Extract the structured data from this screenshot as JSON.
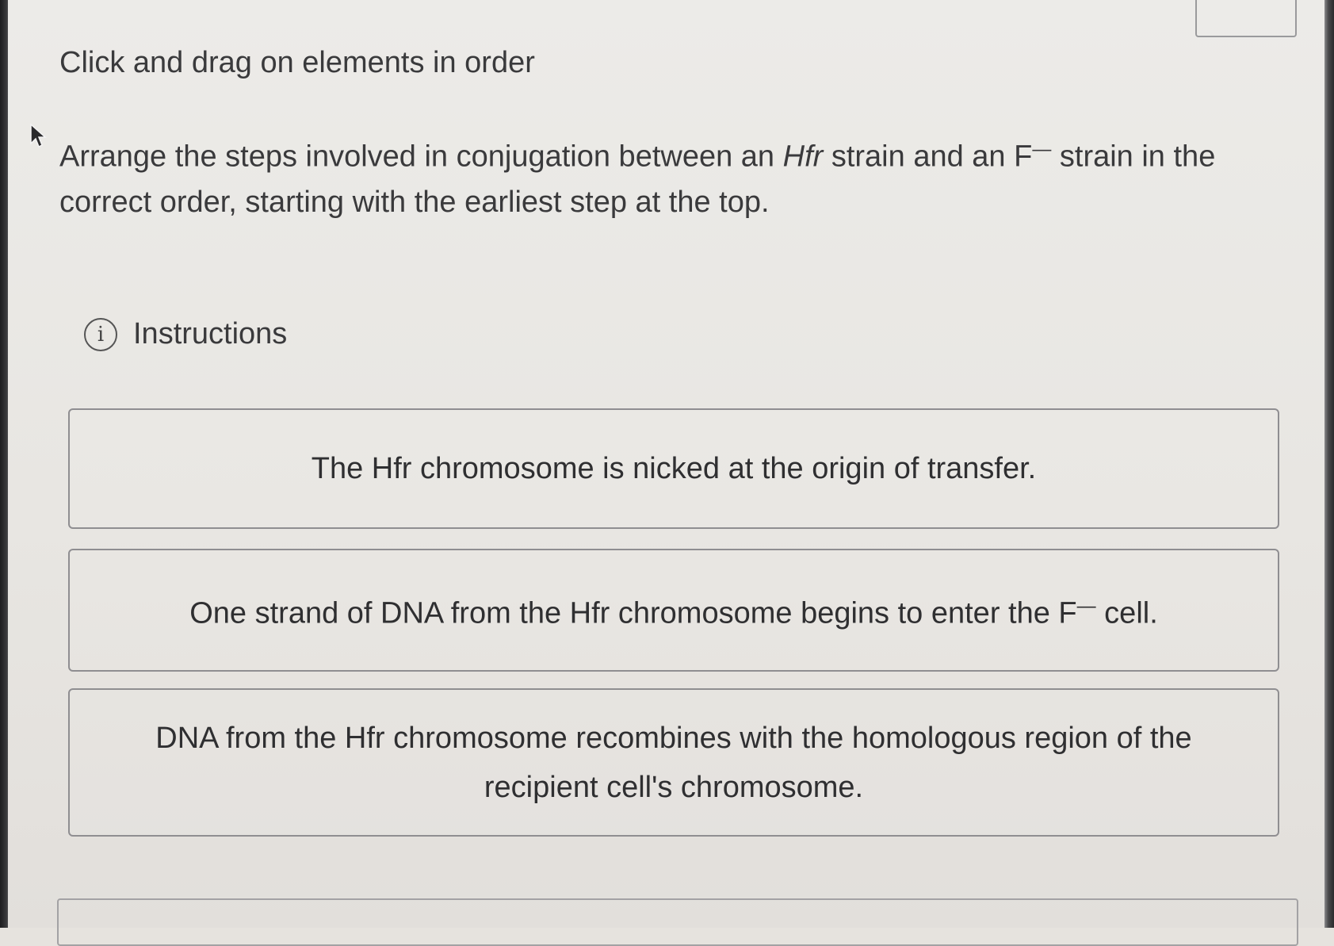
{
  "header": {
    "title": "Click and drag on elements in order"
  },
  "question": {
    "part1": "Arrange the steps involved in conjugation between an ",
    "hfr_italic": "Hfr",
    "part2": " strain and an F",
    "superscript": "—",
    "part3": " strain in the correct order, starting with the earliest step at the top."
  },
  "instructions": {
    "icon_glyph": "i",
    "label": "Instructions"
  },
  "steps": [
    {
      "text": "The Hfr chromosome is nicked at the origin of transfer."
    },
    {
      "text_before": "One strand of DNA from the Hfr chromosome begins to enter the F",
      "superscript": "—",
      "text_after": " cell."
    },
    {
      "text": "DNA from the Hfr chromosome recombines with the homologous region of the recipient cell's chromosome."
    }
  ],
  "icons": {
    "cursor": "mouse-pointer-icon",
    "info": "info-icon"
  }
}
